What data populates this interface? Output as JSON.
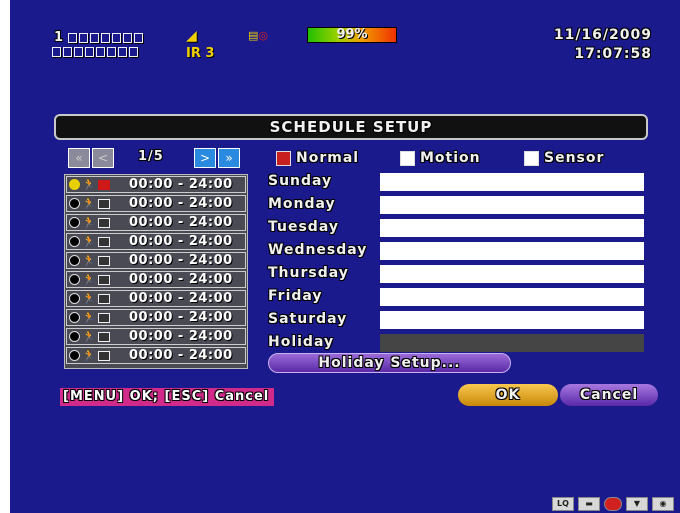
{
  "osd": {
    "channel_prefix": "1",
    "alarm_icon": "speaker-icon",
    "ir_label": "IR 3",
    "rec_icon": "record-clock-icon",
    "hdd_percent": "99%",
    "date": "11/16/2009",
    "time": "17:07:58"
  },
  "dialog": {
    "title": "SCHEDULE SETUP",
    "page": "1/5",
    "nav": {
      "first": "«",
      "prev": "<",
      "next": ">",
      "last": "»"
    },
    "legend": [
      {
        "label": "Normal",
        "color": "#c82020"
      },
      {
        "label": "Motion",
        "color": "#ffffff"
      },
      {
        "label": "Sensor",
        "color": "#ffffff"
      }
    ],
    "schedules": [
      {
        "time": "00:00 - 24:00",
        "active": true
      },
      {
        "time": "00:00 - 24:00",
        "active": false
      },
      {
        "time": "00:00 - 24:00",
        "active": false
      },
      {
        "time": "00:00 - 24:00",
        "active": false
      },
      {
        "time": "00:00 - 24:00",
        "active": false
      },
      {
        "time": "00:00 - 24:00",
        "active": false
      },
      {
        "time": "00:00 - 24:00",
        "active": false
      },
      {
        "time": "00:00 - 24:00",
        "active": false
      },
      {
        "time": "00:00 - 24:00",
        "active": false
      },
      {
        "time": "00:00 - 24:00",
        "active": false
      }
    ],
    "days": [
      "Sunday",
      "Monday",
      "Tuesday",
      "Wednesday",
      "Thursday",
      "Friday",
      "Saturday",
      "Holiday"
    ],
    "holiday_button": "Holiday Setup...",
    "hint": "[MENU] OK; [ESC] Cancel",
    "ok_label": "OK",
    "cancel_label": "Cancel"
  },
  "status_icons": [
    "LQ",
    "screen-icon",
    "record-icon",
    "network-icon",
    "camera-icon"
  ],
  "colors": {
    "background": "#1a1a8c",
    "accent_ok": "#f0b030",
    "accent_cancel": "#8050c8",
    "hint_bg": "#d02a8a"
  }
}
